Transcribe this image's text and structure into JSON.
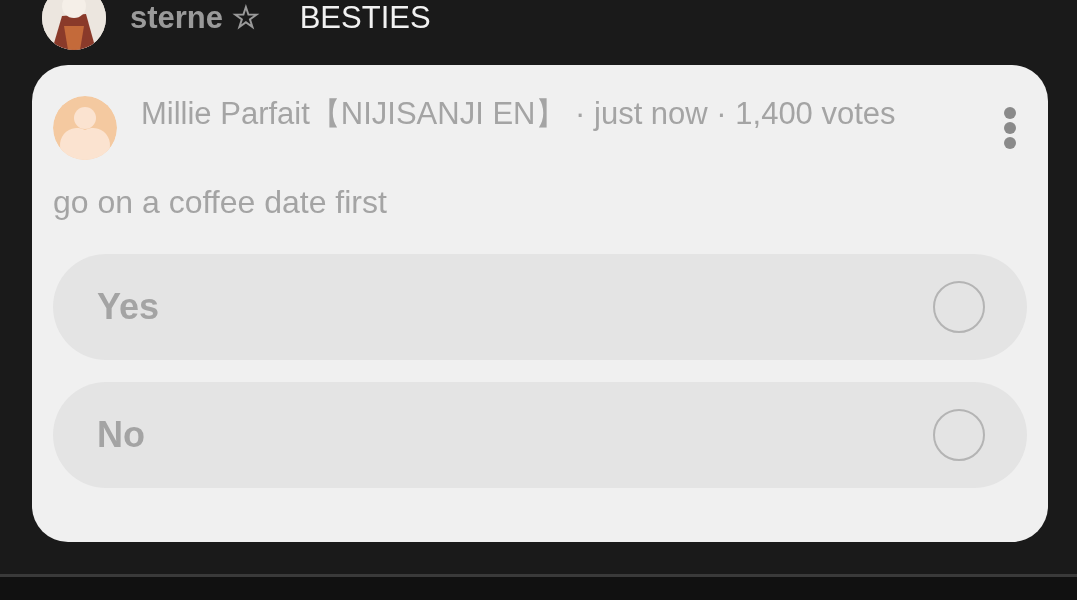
{
  "header": {
    "name": "sterne ☆",
    "title": "BESTIES"
  },
  "poll": {
    "meta": "Millie Parfait【NIJISANJI EN】 · just now · 1,400 votes",
    "question": "go on a coffee date first",
    "options": [
      {
        "label": "Yes",
        "selected": false
      },
      {
        "label": "No",
        "selected": false
      }
    ]
  }
}
